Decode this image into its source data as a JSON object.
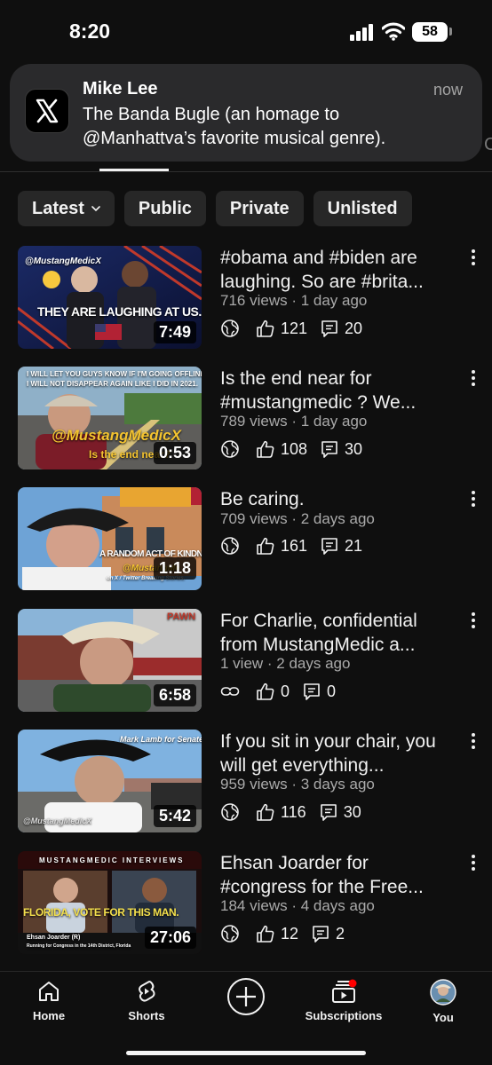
{
  "status_bar": {
    "time": "8:20",
    "battery": "58"
  },
  "notification": {
    "app_icon": "x-logo-icon",
    "sender": "Mike Lee",
    "time": "now",
    "body": "The Banda Bugle (an homage to @Manhattva’s favorite musical genre)."
  },
  "peek_letter": "C",
  "filters": [
    {
      "label": "Latest",
      "has_dropdown": true
    },
    {
      "label": "Public"
    },
    {
      "label": "Private"
    },
    {
      "label": "Unlisted"
    }
  ],
  "videos": [
    {
      "title": "#obama and #biden are laughing. So are #brita...",
      "meta": "716 views · 1 day ago",
      "visibility_icon": "globe-icon",
      "likes": "121",
      "comments": "20",
      "duration": "7:49",
      "thumb_text": [
        "@MustangMedicX",
        "THEY ARE LAUGHING AT US."
      ]
    },
    {
      "title": "Is the end near for #mustangmedic ? We...",
      "meta": "789 views · 1 day ago",
      "visibility_icon": "globe-icon",
      "likes": "108",
      "comments": "30",
      "duration": "0:53",
      "thumb_text": [
        "I WILL LET YOU GUYS KNOW IF I'M GOING OFFLINE.",
        "I WILL NOT DISAPPEAR AGAIN LIKE I DID IN 2021.",
        "@MustangMedicX",
        "Is the end near?"
      ]
    },
    {
      "title": "Be caring.",
      "meta": "709 views · 2 days ago",
      "visibility_icon": "globe-icon",
      "likes": "161",
      "comments": "21",
      "duration": "1:18",
      "thumb_text": [
        "A RANDOM ACT OF KINDNESS.",
        "@MustangMe",
        "on X / Twitter Breaking Stories."
      ]
    },
    {
      "title": "For Charlie, confidential from MustangMedic a...",
      "meta": "1 view · 2 days ago",
      "visibility_icon": "link-icon",
      "likes": "0",
      "comments": "0",
      "duration": "6:58",
      "thumb_text": [
        "PAWN"
      ]
    },
    {
      "title": "If you sit in your chair, you will get everything...",
      "meta": "959 views · 3 days ago",
      "visibility_icon": "globe-icon",
      "likes": "116",
      "comments": "30",
      "duration": "5:42",
      "thumb_text": [
        "Mark Lamb for Senate AZ",
        "@MustangMedicX"
      ]
    },
    {
      "title": "Ehsan Joarder for #congress for the Free...",
      "meta": "184 views · 4 days ago",
      "visibility_icon": "globe-icon",
      "likes": "12",
      "comments": "2",
      "duration": "27:06",
      "thumb_text": [
        "MUSTANGMEDIC INTERVIEWS",
        "FLORIDA, VOTE FOR THIS MAN.",
        "Ehsan Joarder (R)",
        "Running for Congress in the 14th District, Florida"
      ]
    }
  ],
  "bottom_nav": {
    "home": "Home",
    "shorts": "Shorts",
    "create_icon": "plus-circle-icon",
    "subscriptions": "Subscriptions",
    "you": "You"
  }
}
